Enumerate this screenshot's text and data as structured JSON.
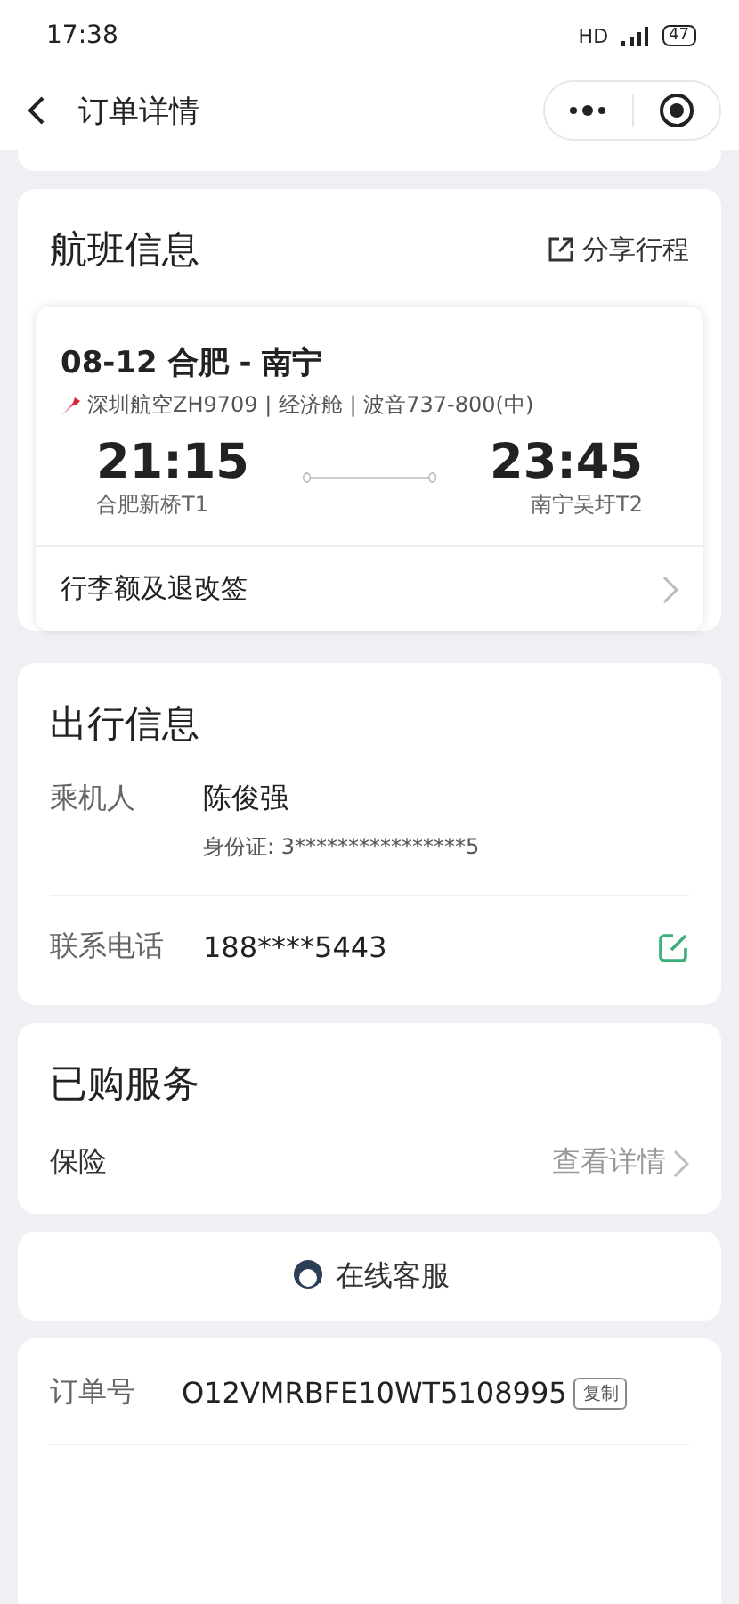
{
  "status_bar": {
    "time": "17:38",
    "network": "HD",
    "battery": "47"
  },
  "nav": {
    "title": "订单详情"
  },
  "flight_section": {
    "title": "航班信息",
    "share": "分享行程",
    "flight": {
      "route": "08-12 合肥 - 南宁",
      "info": "深圳航空ZH9709 | 经济舱 | 波音737-800(中)",
      "depart_time": "21:15",
      "depart_airport": "合肥新桥T1",
      "arrive_time": "23:45",
      "arrive_airport": "南宁吴圩T2"
    },
    "baggage": "行李额及退改签"
  },
  "travel_section": {
    "title": "出行信息",
    "passenger_label": "乘机人",
    "passenger_name": "陈俊强",
    "id_text": "身份证: 3****************5",
    "phone_label": "联系电话",
    "phone": "188****5443"
  },
  "service_section": {
    "title": "已购服务",
    "insurance": "保险",
    "details": "查看详情"
  },
  "customer_service": "在线客服",
  "order": {
    "label": "订单号",
    "number": "O12VMRBFE10WT5108995",
    "copy": "复制"
  }
}
